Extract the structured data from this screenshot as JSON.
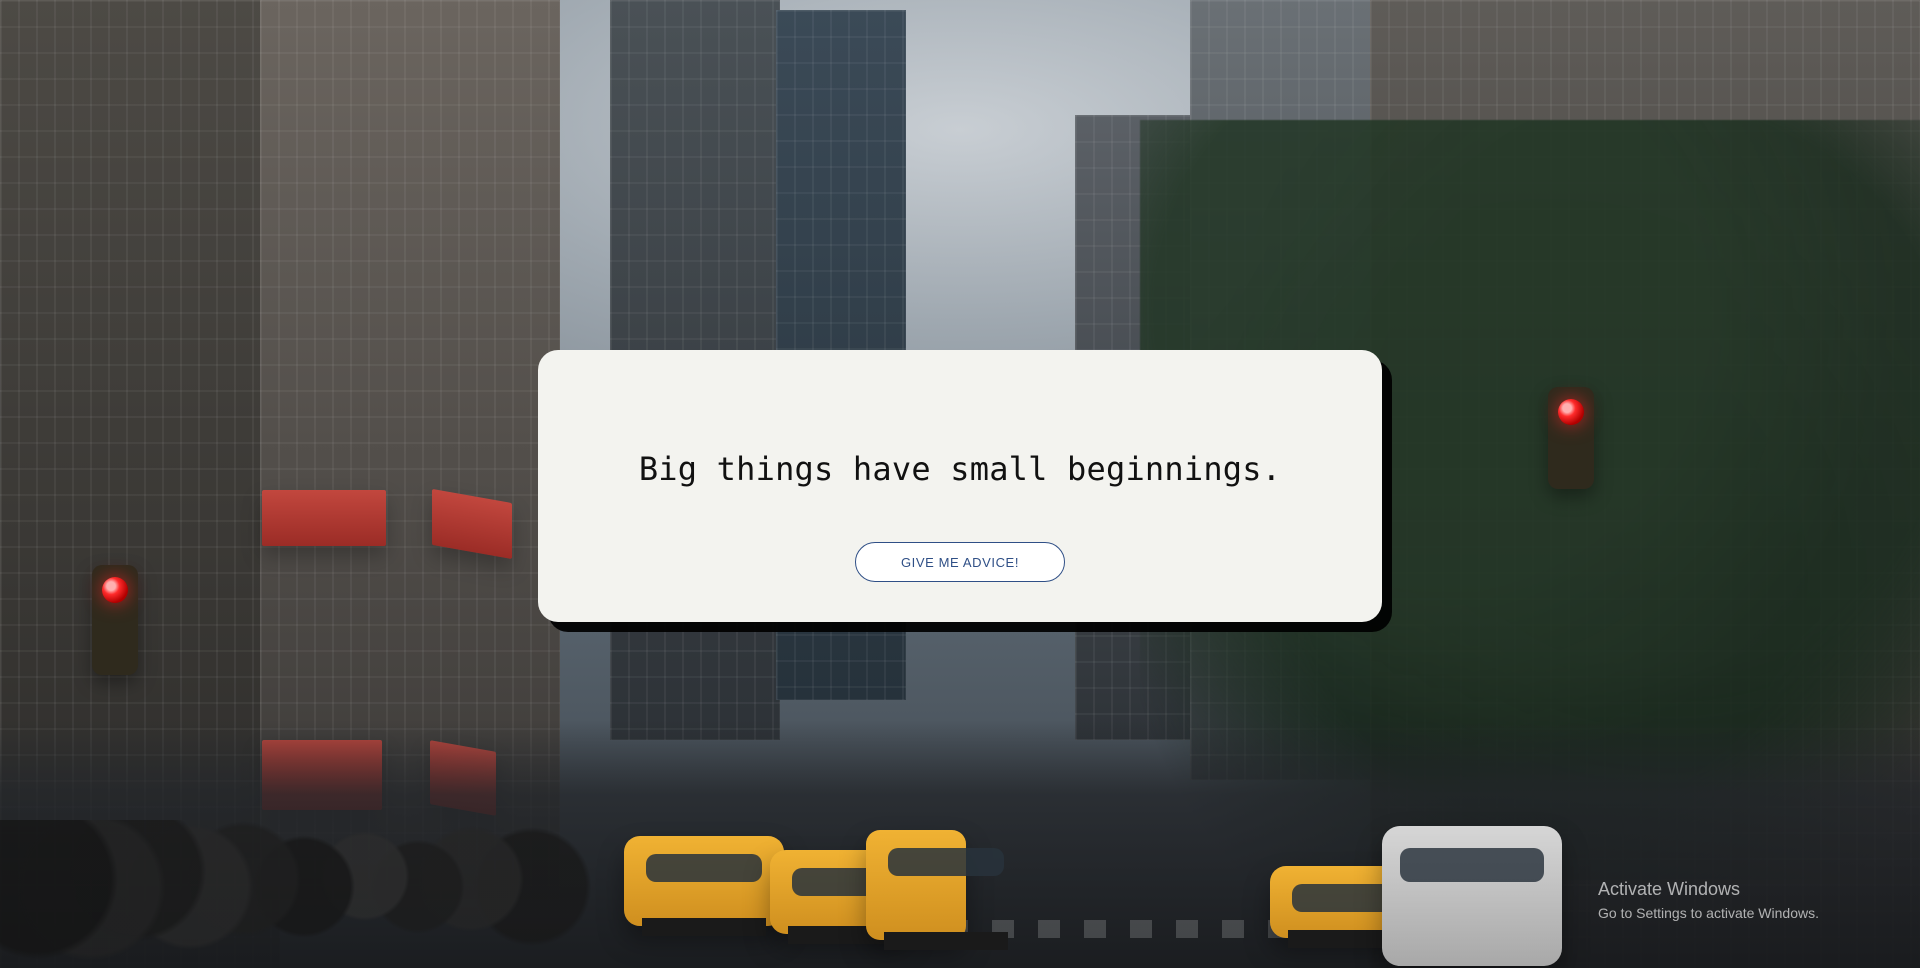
{
  "modal": {
    "quote": "Big things have small beginnings.",
    "button_label": "GIVE ME ADVICE!"
  },
  "watermark": {
    "title": "Activate Windows",
    "subtitle": "Go to Settings to activate Windows."
  },
  "colors": {
    "card_background": "#f3f3ef",
    "button_text": "#2f4f86",
    "button_border": "#2f4f86",
    "shadow": "#000000"
  }
}
